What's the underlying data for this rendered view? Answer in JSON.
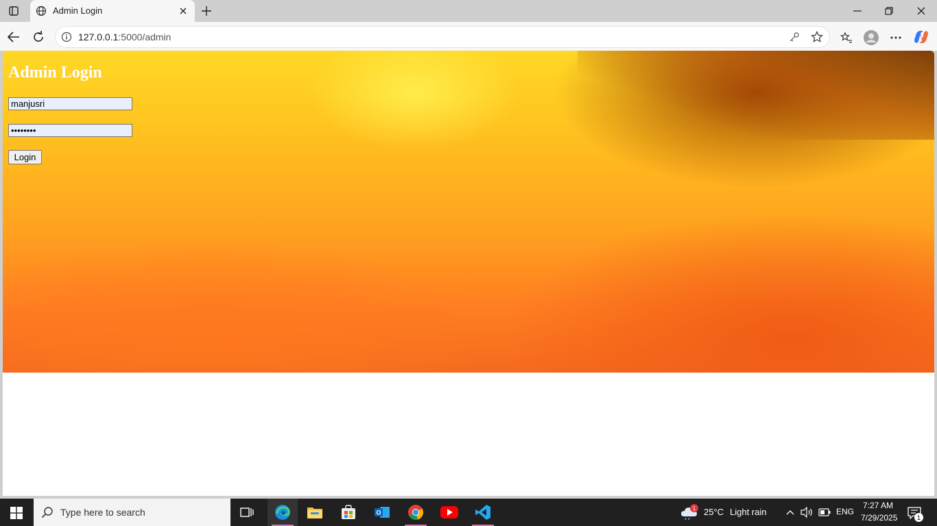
{
  "browser": {
    "tab_title": "Admin Login",
    "url_host": "127.0.0.1",
    "url_path": ":5000/admin"
  },
  "page": {
    "title": "Admin Login",
    "username_value": "manjusri",
    "password_value": "••••••••",
    "login_label": "Login"
  },
  "taskbar": {
    "search_placeholder": "Type here to search",
    "weather_temp": "25°C",
    "weather_desc": "Light rain",
    "weather_badge": "1",
    "language": "ENG",
    "time": "7:27 AM",
    "date": "7/29/2025",
    "notification_count": "1"
  },
  "colors": {
    "accent": "#d878a8",
    "hero_top": "#ffd826",
    "hero_bottom": "#f56a1f"
  }
}
